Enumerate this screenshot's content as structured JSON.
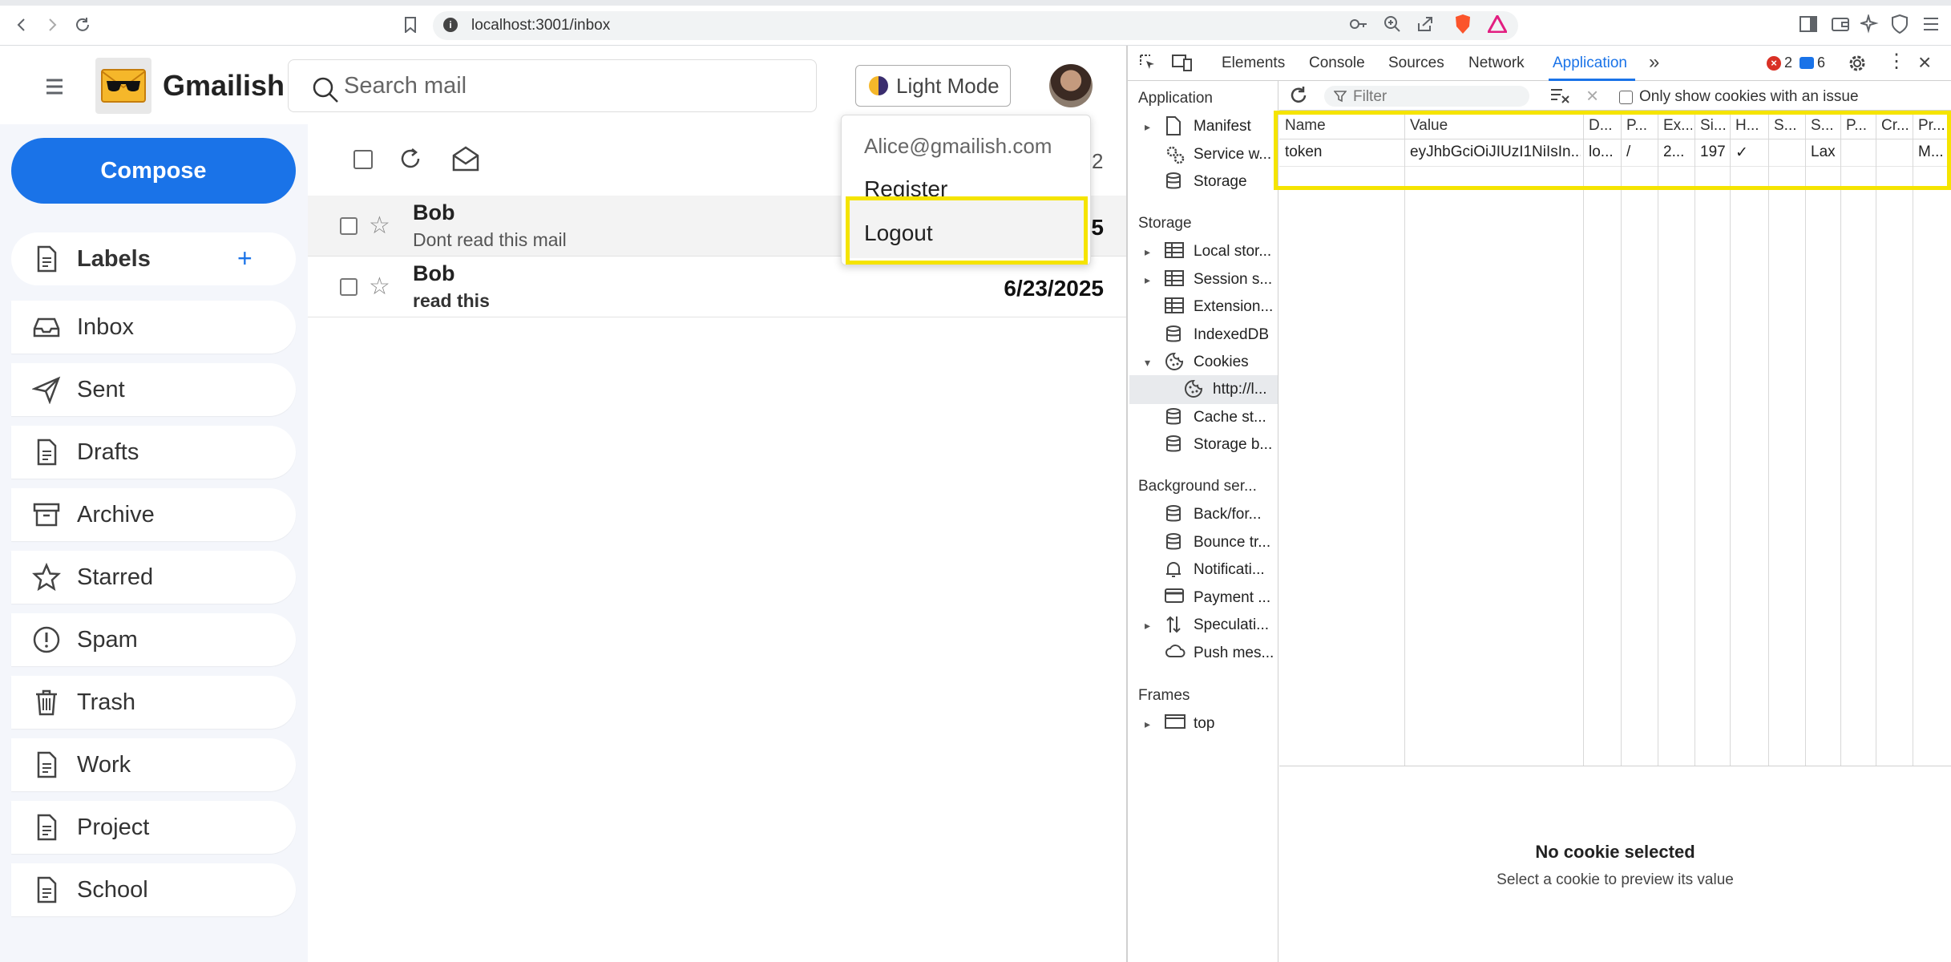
{
  "browser": {
    "url": "localhost:3001/inbox"
  },
  "app": {
    "brand": "Gmailish",
    "search_placeholder": "Search mail",
    "theme_button": "Light Mode",
    "compose": "Compose",
    "labels_title": "Labels",
    "labels_add": "+",
    "sidebar": [
      {
        "label": "Inbox",
        "icon": "inbox-icon"
      },
      {
        "label": "Sent",
        "icon": "send-icon"
      },
      {
        "label": "Drafts",
        "icon": "document-icon"
      },
      {
        "label": "Archive",
        "icon": "archive-icon"
      },
      {
        "label": "Starred",
        "icon": "star-icon"
      },
      {
        "label": "Spam",
        "icon": "alert-icon"
      },
      {
        "label": "Trash",
        "icon": "trash-icon"
      },
      {
        "label": "Work",
        "icon": "document-icon"
      },
      {
        "label": "Project",
        "icon": "document-icon"
      },
      {
        "label": "School",
        "icon": "document-icon"
      }
    ],
    "mail_count": "2",
    "mails": [
      {
        "from": "Bob",
        "subject": "Dont read this mail",
        "date": "5"
      },
      {
        "from": "Bob",
        "subject": "read this",
        "date": "6/23/2025"
      }
    ],
    "account_menu": {
      "email": "Alice@gmailish.com",
      "register": "Register",
      "logout": "Logout"
    }
  },
  "devtools": {
    "tabs": [
      "Elements",
      "Console",
      "Sources",
      "Network",
      "Application"
    ],
    "active_tab": "Application",
    "error_count": "2",
    "message_count": "6",
    "tree": {
      "application_title": "Application",
      "application_items": [
        "Manifest",
        "Service w...",
        "Storage"
      ],
      "storage_title": "Storage",
      "storage_items": [
        "Local stor...",
        "Session s...",
        "Extension...",
        "IndexedDB",
        "Cookies",
        "http://l...",
        "Cache st...",
        "Storage b..."
      ],
      "background_title": "Background ser...",
      "background_items": [
        "Back/for...",
        "Bounce tr...",
        "Notificati...",
        "Payment ...",
        "Speculati...",
        "Push mes..."
      ],
      "frames_title": "Frames",
      "frames_items": [
        "top"
      ]
    },
    "filter_placeholder": "Filter",
    "only_issues_label": "Only show cookies with an issue",
    "cookie_columns": [
      "Name",
      "Value",
      "D...",
      "P...",
      "Ex...",
      "Si...",
      "H...",
      "S...",
      "S...",
      "P...",
      "Cr...",
      "Pr..."
    ],
    "cookie_rows": [
      [
        "token",
        "eyJhbGciOiJIUzI1NiIsIn...",
        "lo...",
        "/",
        "2...",
        "197",
        "✓",
        "",
        "Lax",
        "",
        "",
        "M..."
      ]
    ],
    "empty_title": "No cookie selected",
    "empty_subtitle": "Select a cookie to preview its value"
  }
}
